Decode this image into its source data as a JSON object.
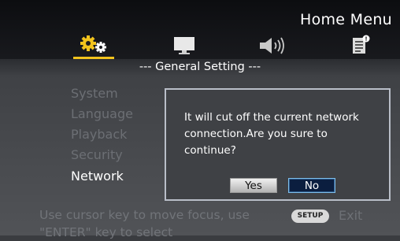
{
  "header": {
    "title": "Home Menu"
  },
  "tabs": [
    {
      "icon": "gear-icon",
      "active": true
    },
    {
      "icon": "monitor-icon",
      "active": false
    },
    {
      "icon": "speaker-icon",
      "active": false
    },
    {
      "icon": "document-info-icon",
      "active": false
    }
  ],
  "section": {
    "title": "--- General Setting ---"
  },
  "menu": {
    "items": [
      {
        "label": "System"
      },
      {
        "label": "Language"
      },
      {
        "label": "Playback"
      },
      {
        "label": "Security"
      },
      {
        "label": "Network"
      }
    ],
    "selected": "Network"
  },
  "dialog": {
    "line1": "It will cut off the current network",
    "line2": "connection.Are you sure to continue?",
    "yes_label": "Yes",
    "no_label": "No",
    "focused": "No"
  },
  "footer": {
    "hint_line1": "Use cursor key to move focus, use",
    "hint_line2": "\"ENTER\" key to select",
    "setup_key": "SETUP",
    "exit_label": "Exit"
  },
  "colors": {
    "accent": "#f2c31d",
    "focus_border": "#7fbde8",
    "dialog_border": "#b9bec8"
  }
}
